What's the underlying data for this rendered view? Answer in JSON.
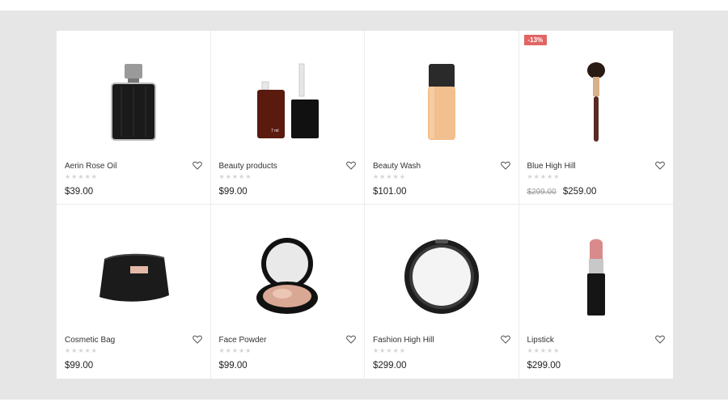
{
  "products": [
    {
      "name": "Aerin Rose Oil",
      "price": "$39.00",
      "old_price": "",
      "rating_stars": "★★★★★",
      "image_icon": "perfume-bottle-icon",
      "badge": ""
    },
    {
      "name": "Beauty products",
      "price": "$99.00",
      "old_price": "",
      "rating_stars": "★★★★★",
      "image_icon": "nail-polish-bottle-icon",
      "bottle_label": "7 ml",
      "badge": ""
    },
    {
      "name": "Beauty Wash",
      "price": "$101.00",
      "old_price": "",
      "rating_stars": "★★★★★",
      "image_icon": "foundation-bottle-icon",
      "badge": ""
    },
    {
      "name": "Blue High Hill",
      "price": "$259.00",
      "old_price": "$299.00",
      "rating_stars": "★★★★★",
      "image_icon": "makeup-brush-icon",
      "badge": "-13%"
    },
    {
      "name": "Cosmetic Bag",
      "price": "$99.00",
      "old_price": "",
      "rating_stars": "★★★★★",
      "image_icon": "cosmetic-bag-icon",
      "badge": ""
    },
    {
      "name": "Face Powder",
      "price": "$99.00",
      "old_price": "",
      "rating_stars": "★★★★★",
      "image_icon": "compact-powder-icon",
      "badge": ""
    },
    {
      "name": "Fashion High Hill",
      "price": "$299.00",
      "old_price": "",
      "rating_stars": "★★★★★",
      "image_icon": "pressed-powder-icon",
      "badge": ""
    },
    {
      "name": "Lipstick",
      "price": "$299.00",
      "old_price": "",
      "rating_stars": "★★★★★",
      "image_icon": "lipstick-icon",
      "badge": ""
    }
  ],
  "colors": {
    "badge": "#e06565",
    "background_band": "#e6e6e6",
    "star_empty": "#d4d4d4"
  }
}
